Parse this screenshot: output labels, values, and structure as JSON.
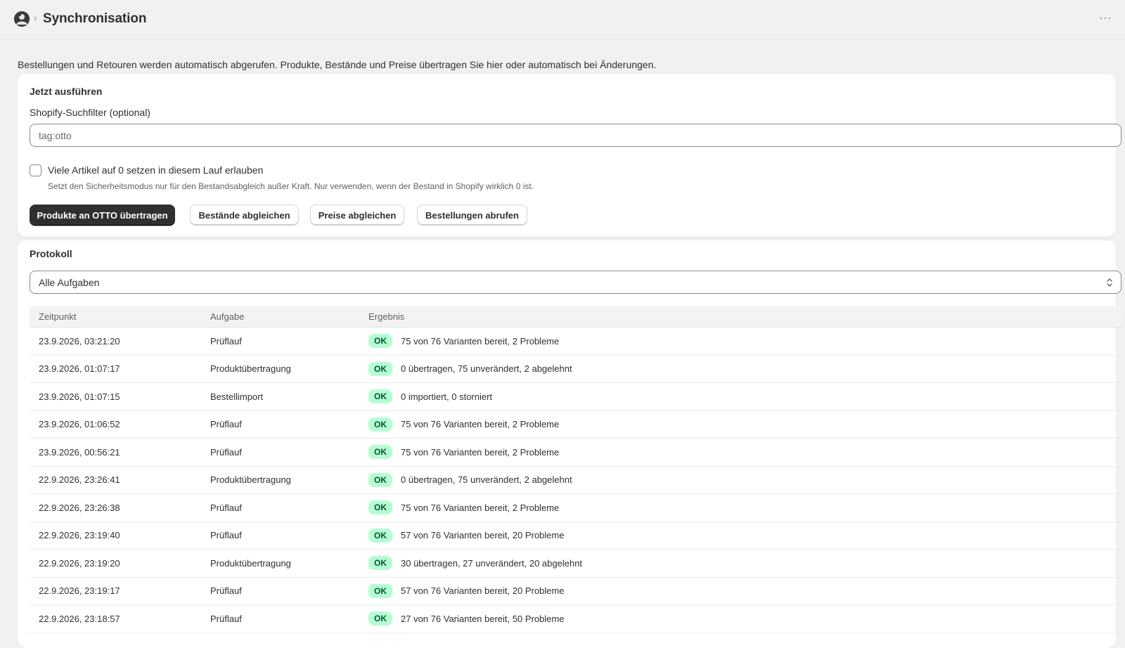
{
  "header": {
    "title": "Synchronisation",
    "more_label": "···"
  },
  "intro_text": "Bestellungen und Retouren werden automatisch abgerufen. Produkte, Bestände und Preise übertragen Sie hier oder automatisch bei Änderungen.",
  "run_now": {
    "title": "Jetzt ausführen",
    "filter_label": "Shopify-Suchfilter (optional)",
    "filter_placeholder": "tag:otto",
    "filter_value": "",
    "checkbox_label": "Viele Artikel auf 0 setzen in diesem Lauf erlauben",
    "checkbox_checked": false,
    "help_text": "Setzt den Sicherheitsmodus nur für den Bestandsabgleich außer Kraft. Nur verwenden, wenn der Bestand in Shopify wirklich 0 ist.",
    "buttons": {
      "push_products": "Produkte an OTTO übertragen",
      "sync_stock": "Bestände abgleichen",
      "sync_prices": "Preise abgleichen",
      "fetch_orders": "Bestellungen abrufen"
    }
  },
  "log": {
    "title": "Protokoll",
    "filter_selected": "Alle Aufgaben",
    "columns": [
      "Zeitpunkt",
      "Aufgabe",
      "Ergebnis"
    ],
    "rows": [
      {
        "time": "23.9.2026, 03:21:20",
        "task": "Prüflauf",
        "status": "OK",
        "result": "75 von 76 Varianten bereit, 2 Probleme"
      },
      {
        "time": "23.9.2026, 01:07:17",
        "task": "Produktübertragung",
        "status": "OK",
        "result": "0 übertragen, 75 unverändert, 2 abgelehnt"
      },
      {
        "time": "23.9.2026, 01:07:15",
        "task": "Bestellimport",
        "status": "OK",
        "result": "0 importiert, 0 storniert"
      },
      {
        "time": "23.9.2026, 01:06:52",
        "task": "Prüflauf",
        "status": "OK",
        "result": "75 von 76 Varianten bereit, 2 Probleme"
      },
      {
        "time": "23.9.2026, 00:56:21",
        "task": "Prüflauf",
        "status": "OK",
        "result": "75 von 76 Varianten bereit, 2 Probleme"
      },
      {
        "time": "22.9.2026, 23:26:41",
        "task": "Produktübertragung",
        "status": "OK",
        "result": "0 übertragen, 75 unverändert, 2 abgelehnt"
      },
      {
        "time": "22.9.2026, 23:26:38",
        "task": "Prüflauf",
        "status": "OK",
        "result": "75 von 76 Varianten bereit, 2 Probleme"
      },
      {
        "time": "22.9.2026, 23:19:40",
        "task": "Prüflauf",
        "status": "OK",
        "result": "57 von 76 Varianten bereit, 20 Probleme"
      },
      {
        "time": "22.9.2026, 23:19:20",
        "task": "Produktübertragung",
        "status": "OK",
        "result": "30 übertragen, 27 unverändert, 20 abgelehnt"
      },
      {
        "time": "22.9.2026, 23:19:17",
        "task": "Prüflauf",
        "status": "OK",
        "result": "57 von 76 Varianten bereit, 20 Probleme"
      },
      {
        "time": "22.9.2026, 23:18:57",
        "task": "Prüflauf",
        "status": "OK",
        "result": "27 von 76 Varianten bereit, 50 Probleme"
      }
    ]
  },
  "colors": {
    "primary_button": "#303030",
    "badge_bg": "#b4fed2",
    "badge_text": "#0c5132",
    "page_bg": "#f1f1f1"
  },
  "icons": {
    "app": "app-logo-icon",
    "breadcrumb": "chevron-right-icon",
    "more": "ellipsis-icon",
    "select": "select-arrows-icon"
  }
}
